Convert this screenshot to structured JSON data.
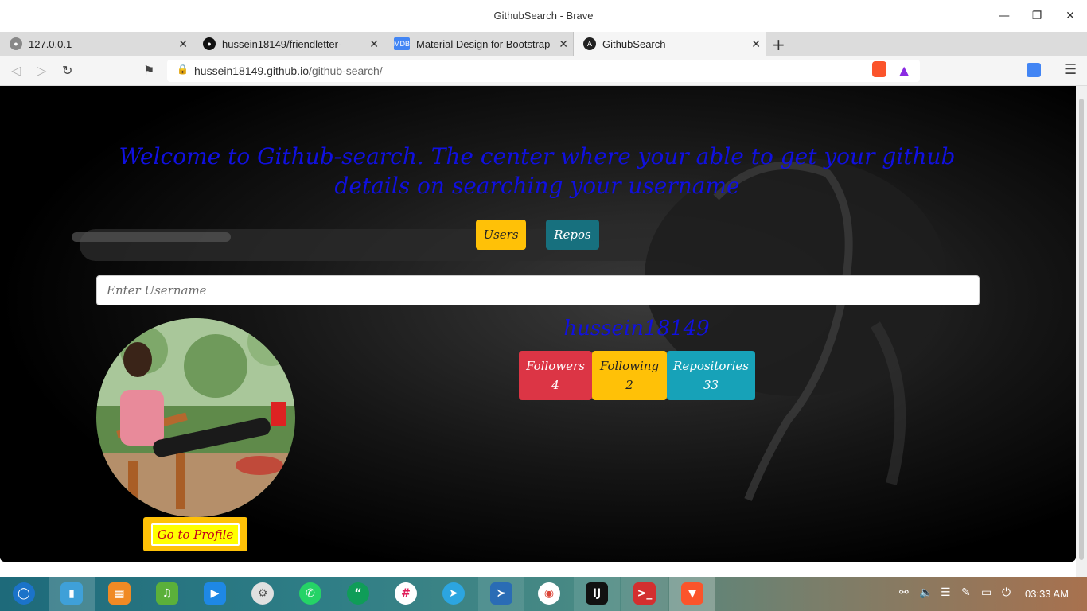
{
  "window": {
    "title": "GithubSearch - Brave"
  },
  "tabs": [
    {
      "label": "127.0.0.1",
      "active": false
    },
    {
      "label": "hussein18149/friendletter-",
      "active": false
    },
    {
      "label": "Material Design for Bootstrap",
      "active": false
    },
    {
      "label": "GithubSearch",
      "active": true
    }
  ],
  "address": {
    "host": "hussein18149.github.io",
    "path": "/github-search/"
  },
  "page": {
    "headline": "Welcome to Github-search. The center where your able to get your github details on searching your username",
    "users_button": "Users",
    "repos_button": "Repos",
    "search_placeholder": "Enter Username",
    "username": "hussein18149",
    "stats": {
      "followers_label": "Followers",
      "followers_value": "4",
      "following_label": "Following",
      "following_value": "2",
      "repos_label": "Repositories",
      "repos_value": "33"
    },
    "profile_button": "Go to Profile"
  },
  "taskbar": {
    "clock": "03:33 AM"
  },
  "colors": {
    "headline": "#1010e0",
    "users_btn": "#ffc107",
    "repos_btn": "#17707e",
    "followers": "#dc3545",
    "following": "#ffc107",
    "repos": "#17a2b8"
  }
}
